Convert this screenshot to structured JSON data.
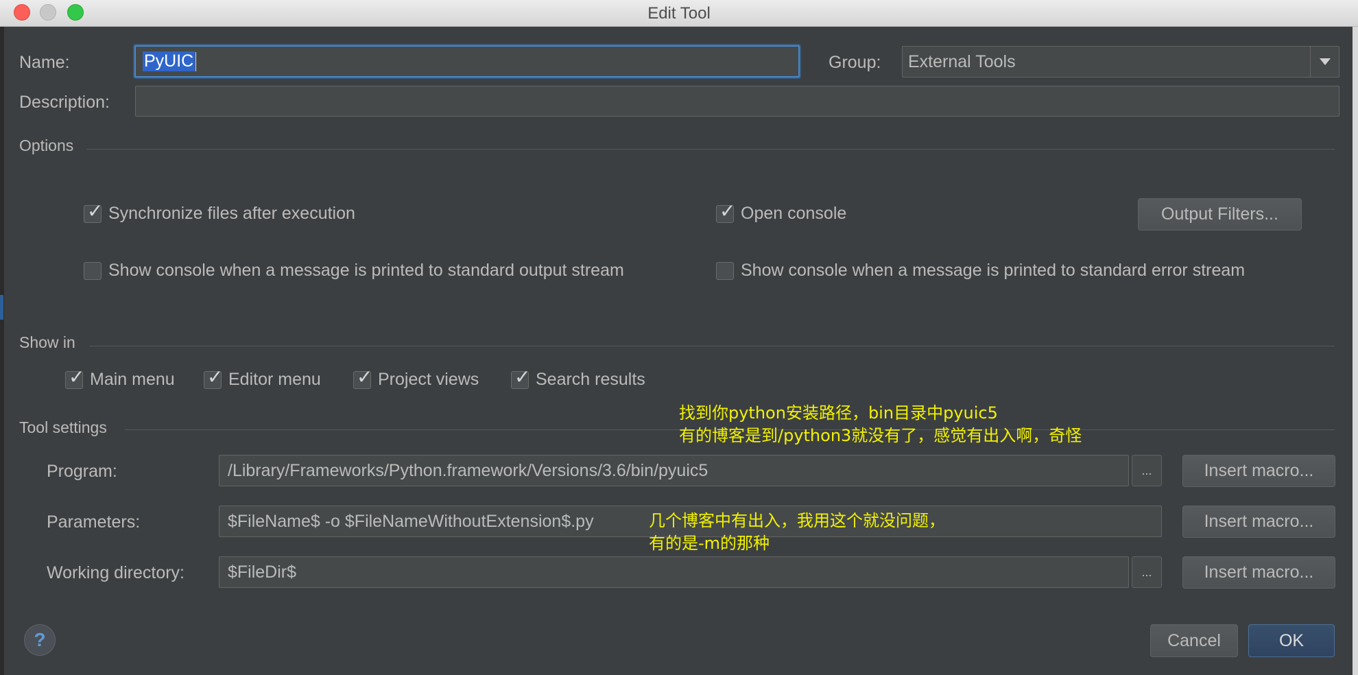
{
  "window": {
    "title": "Edit Tool"
  },
  "form": {
    "name_label": "Name:",
    "name_value": "PyUIC",
    "group_label": "Group:",
    "group_value": "External Tools",
    "description_label": "Description:",
    "description_value": ""
  },
  "options": {
    "title": "Options",
    "sync_files": {
      "label": "Synchronize files after execution",
      "checked": true
    },
    "open_console": {
      "label": "Open console",
      "checked": true
    },
    "output_filters_label": "Output Filters...",
    "show_console_stdout": {
      "label": "Show console when a message is printed to standard output stream",
      "checked": false
    },
    "show_console_stderr": {
      "label": "Show console when a message is printed to standard error stream",
      "checked": false
    }
  },
  "show_in": {
    "title": "Show in",
    "items": [
      {
        "label": "Main menu",
        "checked": true
      },
      {
        "label": "Editor menu",
        "checked": true
      },
      {
        "label": "Project views",
        "checked": true
      },
      {
        "label": "Search results",
        "checked": true
      }
    ]
  },
  "tool_settings": {
    "title": "Tool settings",
    "program_label": "Program:",
    "program_value": "/Library/Frameworks/Python.framework/Versions/3.6/bin/pyuic5",
    "parameters_label": "Parameters:",
    "parameters_value": "$FileName$ -o $FileNameWithoutExtension$.py",
    "working_dir_label": "Working directory:",
    "working_dir_value": "$FileDir$",
    "browse_label": "...",
    "insert_macro_label": "Insert macro..."
  },
  "annotations": {
    "program_note_line1": "找到你python安装路径，bin目录中pyuic5",
    "program_note_line2": "有的博客是到/python3就没有了，感觉有出入啊，奇怪",
    "params_note_line1": "几个博客中有出入，我用这个就没问题，",
    "params_note_line2": "有的是-m的那种"
  },
  "footer": {
    "help_label": "?",
    "cancel_label": "Cancel",
    "ok_label": "OK"
  },
  "colors": {
    "background": "#3c3f41",
    "field": "#45494a",
    "selection": "#2f65ca",
    "focus": "#4a87c7",
    "annotation": "#f2f200",
    "ok_button": "#2f4461"
  },
  "icons": {
    "close": "close-icon",
    "minimize": "minimize-icon",
    "maximize": "maximize-icon",
    "dropdown": "chevron-down-icon",
    "checkbox": "checkmark-icon",
    "help": "help-icon"
  }
}
